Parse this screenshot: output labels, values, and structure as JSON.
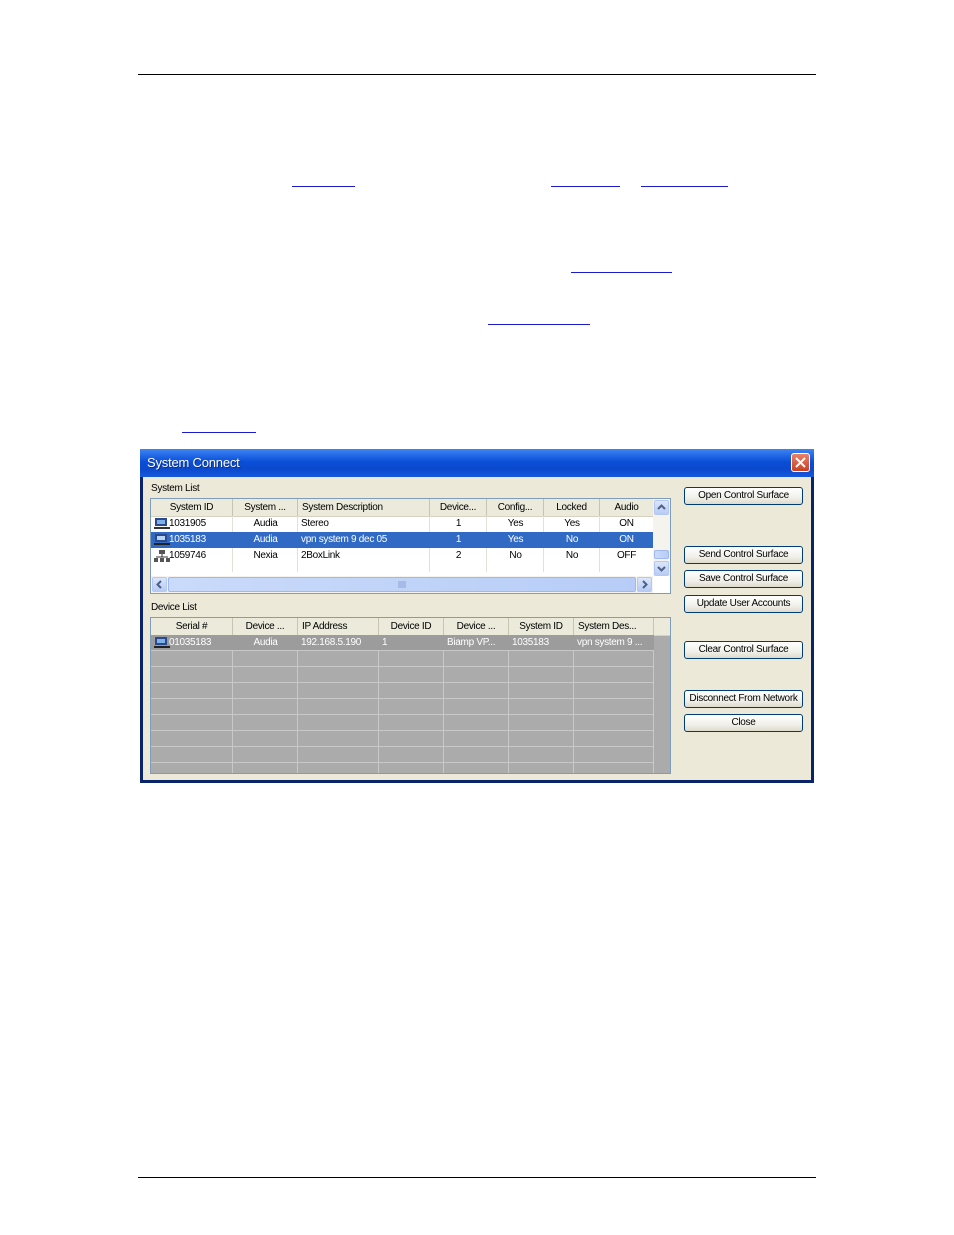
{
  "dialog": {
    "title": "System Connect",
    "system_list_label": "System List",
    "device_list_label": "Device List"
  },
  "system_list": {
    "columns": [
      "System ID",
      "System ...",
      "System Description",
      "Device...",
      "Config...",
      "Locked",
      "Audio"
    ],
    "rows": [
      {
        "system_id": "1031905",
        "system_type": "Audia",
        "description": "Stereo",
        "devices": "1",
        "config": "Yes",
        "locked": "Yes",
        "audio": "ON",
        "icon": "network-computer-icon",
        "selected": false
      },
      {
        "system_id": "1035183",
        "system_type": "Audia",
        "description": "vpn system 9 dec 05",
        "devices": "1",
        "config": "Yes",
        "locked": "No",
        "audio": "ON",
        "icon": "network-computer-icon",
        "selected": true
      },
      {
        "system_id": "1059746",
        "system_type": "Nexia",
        "description": "2BoxLink",
        "devices": "2",
        "config": "No",
        "locked": "No",
        "audio": "OFF",
        "icon": "network-node-icon",
        "selected": false
      }
    ]
  },
  "device_list": {
    "columns": [
      "Serial #",
      "Device ...",
      "IP Address",
      "Device ID",
      "Device ...",
      "System ID",
      "System Des..."
    ],
    "rows": [
      {
        "serial": "01035183",
        "device_type": "Audia",
        "ip": "192.168.5.190",
        "device_id": "1",
        "device_model": "Biamp VP...",
        "system_id": "1035183",
        "system_description": "vpn system 9 ..."
      }
    ]
  },
  "buttons": {
    "open_control_surface": "Open Control Surface",
    "send_control_surface": "Send Control Surface",
    "save_control_surface": "Save Control Surface",
    "update_user_accounts": "Update User Accounts",
    "clear_control_surface": "Clear Control Surface",
    "disconnect_from_network": "Disconnect From Network",
    "close": "Close"
  },
  "colors": {
    "title_bar": "#0b4fd8",
    "selection": "#316ac5",
    "dialog_face": "#ece9d8",
    "device_list_background": "#ababab"
  }
}
